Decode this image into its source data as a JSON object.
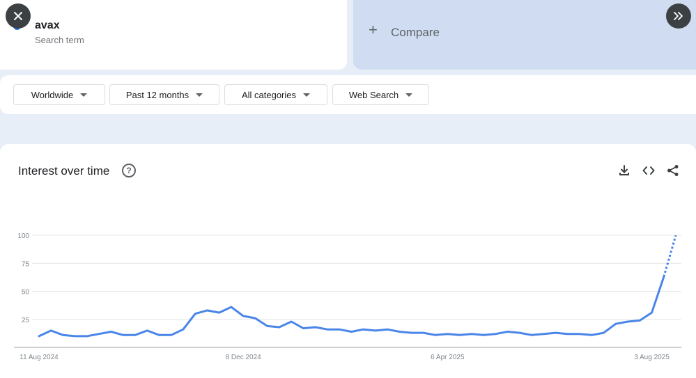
{
  "search_term": {
    "name": "avax",
    "label": "Search term",
    "color": "#1a73e8"
  },
  "compare": {
    "label": "Compare"
  },
  "filters": {
    "region": "Worldwide",
    "time_range": "Past 12 months",
    "category": "All categories",
    "search_type": "Web Search"
  },
  "chart": {
    "title": "Interest over time",
    "actions": [
      "download-icon",
      "embed-icon",
      "share-icon"
    ]
  },
  "colors": {
    "line": "#4a86e8",
    "background": "#e8eef7",
    "compare_card": "#cfdcf1"
  },
  "chart_data": {
    "type": "line",
    "title": "Interest over time",
    "xlabel": "",
    "ylabel": "",
    "ylim": [
      0,
      100
    ],
    "yticks": [
      25,
      50,
      75,
      100
    ],
    "xtick_labels": [
      "11 Aug 2024",
      "8 Dec 2024",
      "6 Apr 2025",
      "3 Aug 2025"
    ],
    "grid": true,
    "series": [
      {
        "name": "",
        "values": [
          10,
          15,
          11,
          10,
          10,
          12,
          14,
          11,
          11,
          15,
          11,
          11,
          16,
          30,
          33,
          31,
          36,
          28,
          26,
          19,
          18,
          23,
          17,
          18,
          16,
          16,
          14,
          16,
          15,
          16,
          14,
          13,
          13,
          11,
          12,
          11,
          12,
          11,
          12,
          14,
          13,
          11,
          12,
          13,
          12,
          12,
          11,
          13,
          21,
          23,
          24,
          31,
          63,
          100
        ],
        "partial_last_point": true
      }
    ]
  }
}
